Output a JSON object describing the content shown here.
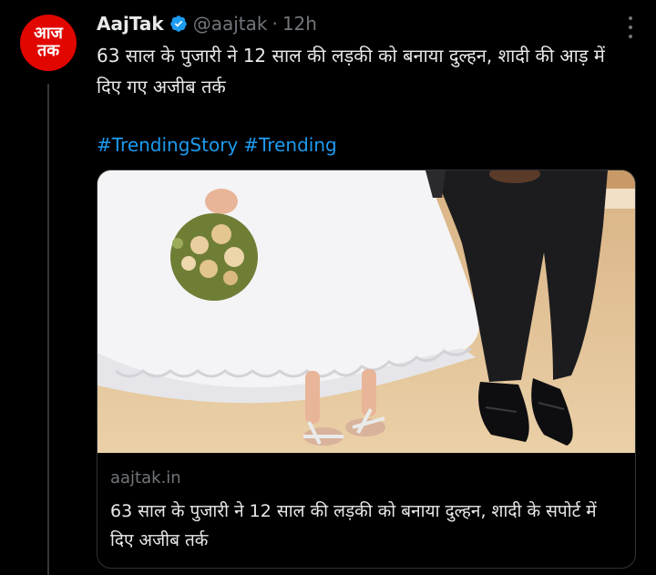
{
  "author": {
    "name": "AajTak",
    "handle": "@aajtak",
    "time": "12h",
    "avatar_text_top": "आज",
    "avatar_text_bottom": "तक",
    "avatar_color": "#e10600",
    "verified": true
  },
  "tweet": {
    "text": "63 साल के पुजारी ने 12 साल की लड़की को बनाया दुल्हन, शादी की आड़ में दिए गए अजीब तर्क",
    "hashtags": [
      "#TrendingStory",
      "#Trending"
    ]
  },
  "card": {
    "image_description": "wedding-photo",
    "domain": "aajtak.in",
    "title": "63 साल के पुजारी ने 12 साल की लड़की को बनाया दुल्हन, शादी के सपोर्ट में दिए अजीब तर्क"
  },
  "colors": {
    "background": "#000000",
    "text": "#e7e9ea",
    "secondary": "#71767b",
    "link": "#1d9bf0",
    "verified": "#1d9bf0"
  },
  "icons": {
    "verified": "verified-badge-icon",
    "more": "more-options-icon"
  }
}
